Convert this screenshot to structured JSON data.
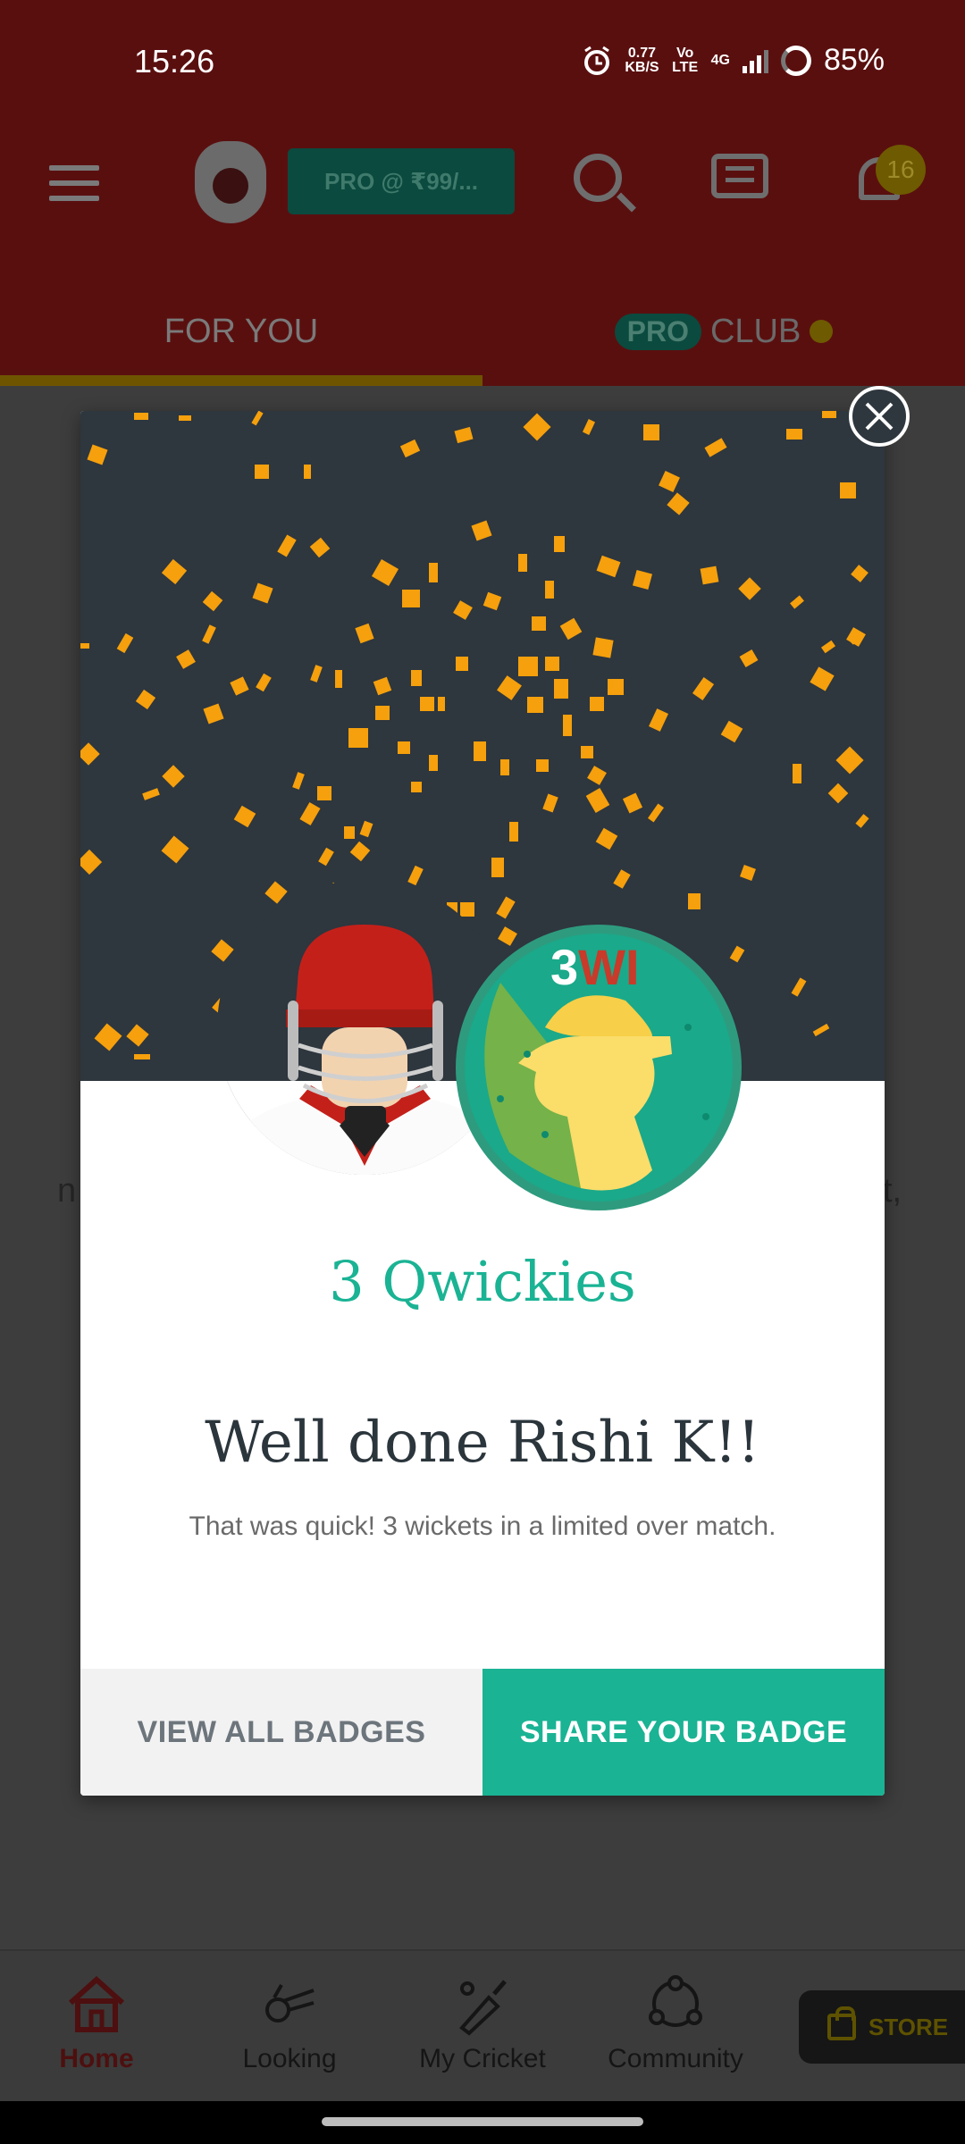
{
  "status_bar": {
    "time": "15:26",
    "net_speed": "0.77",
    "net_unit": "KB/S",
    "volte": "Vo LTE",
    "network": "4G",
    "battery": "85%"
  },
  "header": {
    "pro_button": "PRO @ ₹99/...",
    "notification_count": "16",
    "tabs": {
      "for_you": "FOR YOU",
      "pro_badge": "PRO",
      "club": "CLUB"
    }
  },
  "background_text": {
    "left_fragment": "n",
    "right_fragment": "t,"
  },
  "modal": {
    "badge_code_number": "3",
    "badge_code_letters": "WI",
    "badge_name": "3 Qwickies",
    "greeting": "Well done Rishi K!!",
    "description": "That was quick! 3 wickets in a limited over match.",
    "view_all_label": "VIEW ALL BADGES",
    "share_label": "SHARE YOUR BADGE"
  },
  "bottom_nav": {
    "items": [
      {
        "label": "Home",
        "icon": "home-icon"
      },
      {
        "label": "Looking",
        "icon": "binoculars-icon"
      },
      {
        "label": "My Cricket",
        "icon": "cricket-bat-icon"
      },
      {
        "label": "Community",
        "icon": "community-icon"
      }
    ],
    "store_label": "STORE"
  },
  "colors": {
    "accent_green": "#1ab394",
    "confetti": "#f5a00c",
    "helmet_red": "#b5241c",
    "header_bg": "#5a0f0f"
  }
}
